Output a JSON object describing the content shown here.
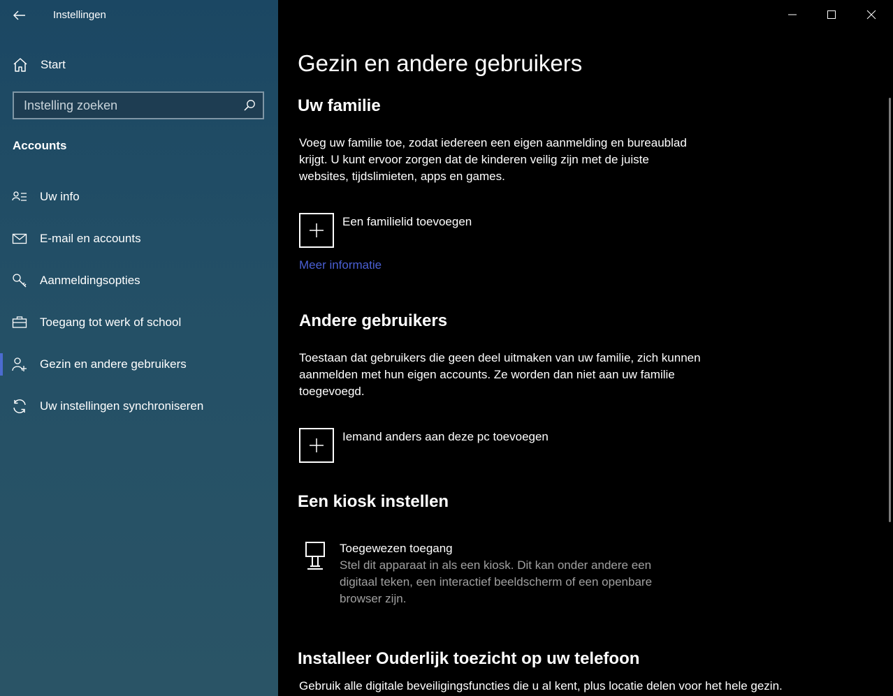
{
  "window": {
    "title": "Instellingen"
  },
  "sidebar": {
    "start_label": "Start",
    "search": {
      "placeholder": "Instelling zoeken",
      "value": ""
    },
    "section": "Accounts",
    "items": [
      {
        "label": "Uw info",
        "icon": "user-info-icon"
      },
      {
        "label": "E-mail en accounts",
        "icon": "mail-icon"
      },
      {
        "label": "Aanmeldingsopties",
        "icon": "key-icon"
      },
      {
        "label": "Toegang tot werk of school",
        "icon": "briefcase-icon"
      },
      {
        "label": "Gezin en andere gebruikers",
        "icon": "family-icon",
        "active": true
      },
      {
        "label": "Uw instellingen synchroniseren",
        "icon": "sync-icon"
      }
    ]
  },
  "main": {
    "title": "Gezin en andere gebruikers",
    "family": {
      "heading": "Uw familie",
      "description": "Voeg uw familie toe, zodat iedereen een eigen aanmelding en bureaublad krijgt. U kunt ervoor zorgen dat de kinderen veilig zijn met de juiste websites, tijdslimieten, apps en games.",
      "add_label": "Een familielid toevoegen",
      "more_info": "Meer informatie"
    },
    "others": {
      "heading": "Andere gebruikers",
      "description": "Toestaan dat gebruikers die geen deel uitmaken van uw familie, zich kunnen aanmelden met hun eigen accounts. Ze worden dan niet aan uw familie toegevoegd.",
      "add_label": "Iemand anders aan deze pc toevoegen"
    },
    "kiosk": {
      "heading": "Een kiosk instellen",
      "title": "Toegewezen toegang",
      "description": "Stel dit apparaat in als een kiosk. Dit kan onder andere een digitaal teken, een interactief beeldscherm of een openbare browser zijn."
    },
    "parental": {
      "heading": "Installeer Ouderlijk toezicht op uw telefoon",
      "description": "Gebruik alle digitale beveiligingsfuncties die u al kent, plus locatie delen voor het hele gezin."
    }
  },
  "colors": {
    "sidebar": "#1e4a62",
    "accent": "#4c6bd0",
    "link": "#4a5fd4",
    "background": "#000000"
  }
}
